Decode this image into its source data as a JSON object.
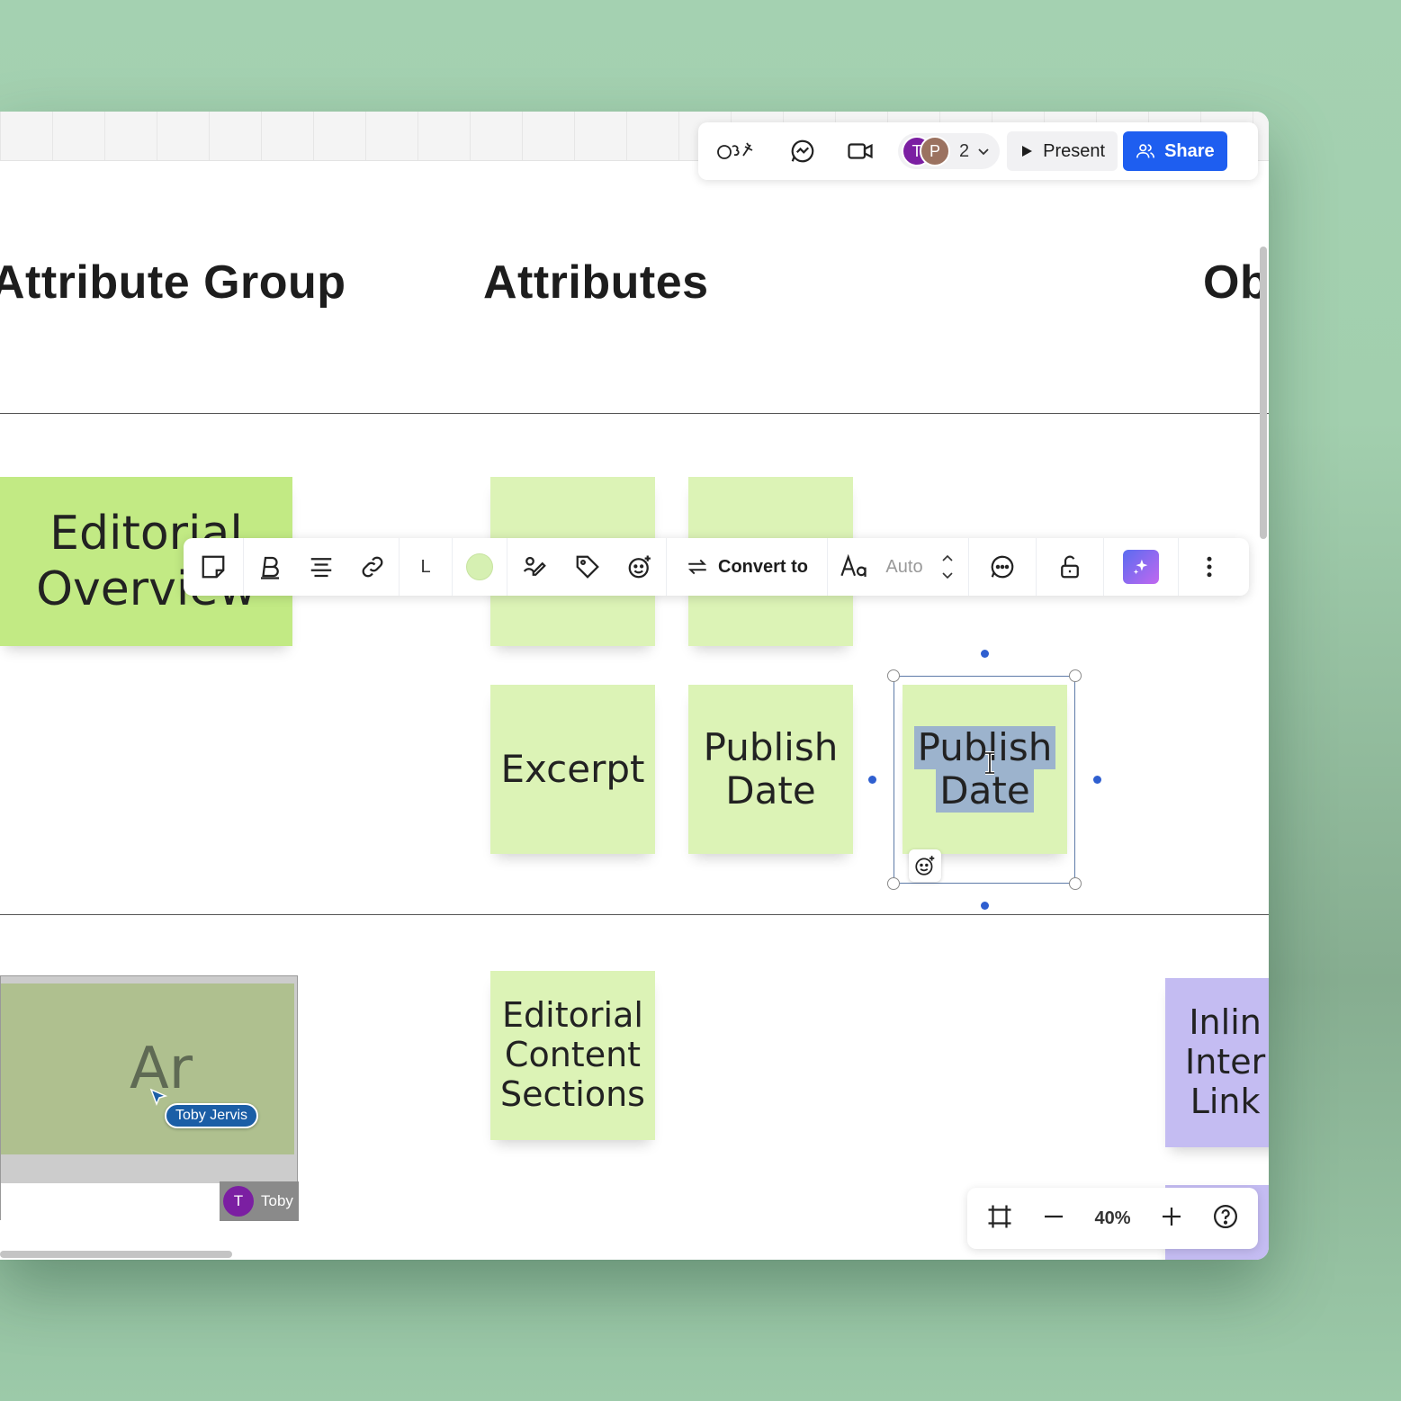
{
  "headings": {
    "attribute_group": "Attribute Group",
    "attributes": "Attributes",
    "objects_partial": "Ob"
  },
  "stickies": {
    "editorial_overview": "Editorial\nOverview",
    "excerpt": "Excerpt",
    "publish_date": "Publish\nDate",
    "publish_date_selected_line1": "Publish",
    "publish_date_selected_line2": "Date",
    "editorial_content_sections": "Editorial\nContent\nSections",
    "inline_internal_links_partial": "Inlin\nInter\nLink"
  },
  "top_toolbar": {
    "collaborators": [
      {
        "initial": "T",
        "color": "#7b1fa2"
      },
      {
        "initial": "P",
        "color": "#9b7260"
      }
    ],
    "collaborator_count": "2",
    "present_label": "Present",
    "share_label": "Share"
  },
  "context_toolbar": {
    "size_label": "L",
    "fill_color": "#d6f0b2",
    "convert_label": "Convert to",
    "font_size_label": "Auto"
  },
  "embed": {
    "preview_text": "Ar",
    "cursor_user": "Toby Jervis",
    "owner_initial": "T",
    "owner_name": "Toby"
  },
  "zoom": {
    "level": "40%"
  },
  "colors": {
    "accent": "#1e5ef0",
    "sticky_green": "#dcf3b6",
    "sticky_green_dark": "#c2ea84",
    "sticky_purple": "#c4bcf2",
    "selection": "#9cb3cd"
  }
}
